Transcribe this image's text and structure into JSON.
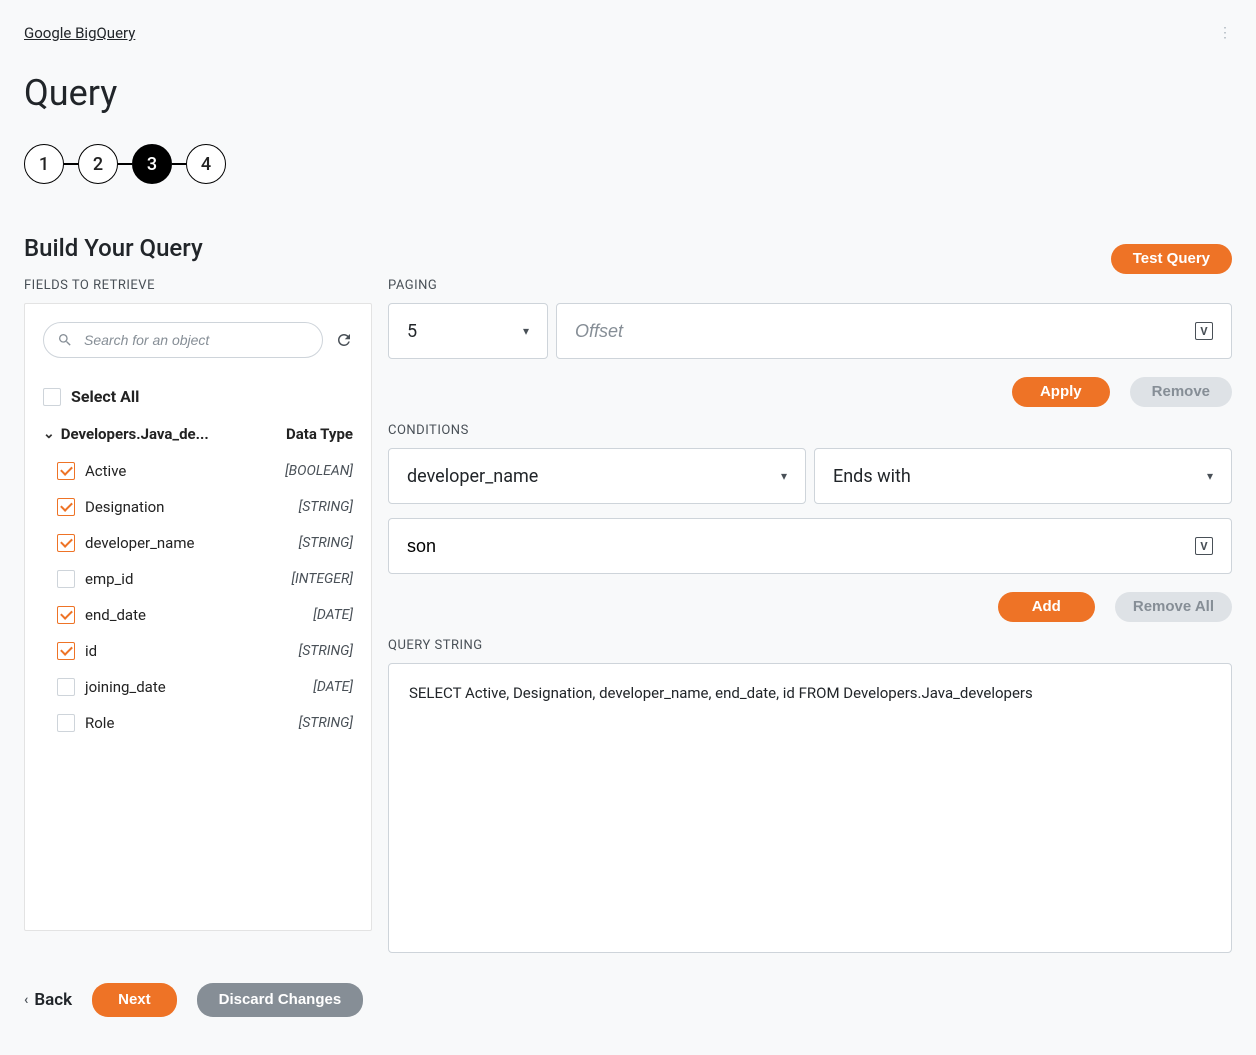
{
  "breadcrumb": {
    "text": "Google BigQuery"
  },
  "page_title": "Query",
  "stepper": {
    "steps": [
      "1",
      "2",
      "3",
      "4"
    ],
    "active_index": 2
  },
  "section_title": "Build Your Query",
  "left": {
    "fields_label": "FIELDS TO RETRIEVE",
    "search_placeholder": "Search for an object",
    "select_all_label": "Select All",
    "table_name": "Developers.Java_de...",
    "data_type_header": "Data Type",
    "fields": [
      {
        "name": "Active",
        "type": "[BOOLEAN]",
        "checked": true
      },
      {
        "name": "Designation",
        "type": "[STRING]",
        "checked": true
      },
      {
        "name": "developer_name",
        "type": "[STRING]",
        "checked": true
      },
      {
        "name": "emp_id",
        "type": "[INTEGER]",
        "checked": false
      },
      {
        "name": "end_date",
        "type": "[DATE]",
        "checked": true
      },
      {
        "name": "id",
        "type": "[STRING]",
        "checked": true
      },
      {
        "name": "joining_date",
        "type": "[DATE]",
        "checked": false
      },
      {
        "name": "Role",
        "type": "[STRING]",
        "checked": false
      }
    ]
  },
  "right": {
    "test_query_label": "Test Query",
    "paging_label": "PAGING",
    "paging_limit": "5",
    "offset_placeholder": "Offset",
    "apply_label": "Apply",
    "remove_label": "Remove",
    "conditions_label": "CONDITIONS",
    "condition_field": "developer_name",
    "condition_operator": "Ends with",
    "condition_value": "son",
    "add_label": "Add",
    "remove_all_label": "Remove All",
    "query_string_label": "QUERY STRING",
    "query_string": "SELECT Active, Designation, developer_name, end_date, id FROM Developers.Java_developers"
  },
  "footer": {
    "back_label": "Back",
    "next_label": "Next",
    "discard_label": "Discard Changes"
  }
}
